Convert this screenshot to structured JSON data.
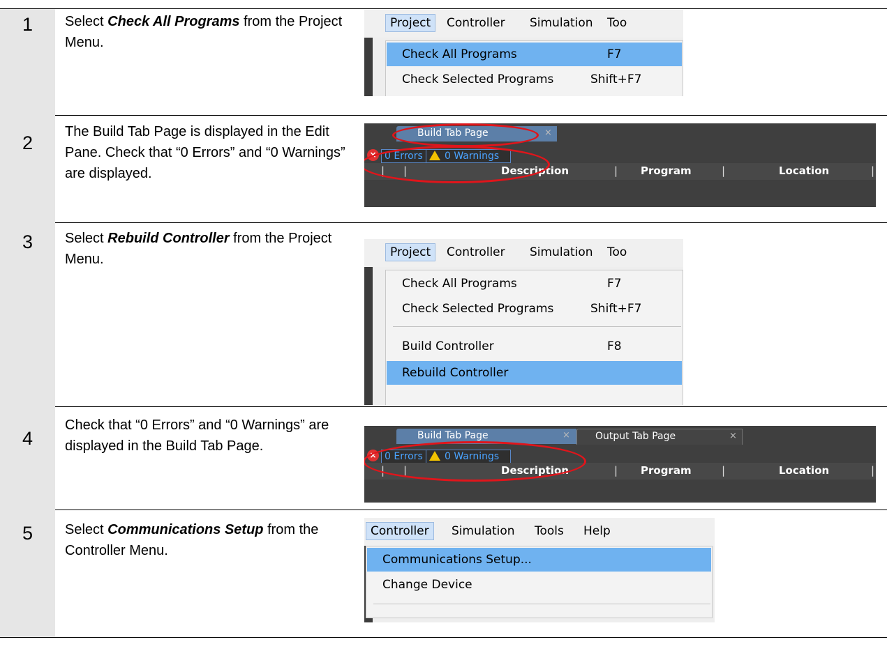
{
  "steps": [
    {
      "number": "1",
      "parts": [
        {
          "text": "Select ",
          "bold": false
        },
        {
          "text": "Check All Programs",
          "bold": true
        },
        {
          "text": " from the Project Menu.",
          "bold": false
        }
      ]
    },
    {
      "number": "2",
      "parts": [
        {
          "text": "The Build Tab Page is displayed in the Edit Pane. Check that “0 Errors” and “0 Warnings” are displayed.",
          "bold": false
        }
      ]
    },
    {
      "number": "3",
      "parts": [
        {
          "text": "Select ",
          "bold": false
        },
        {
          "text": "Rebuild Controller",
          "bold": true
        },
        {
          "text": " from the Project Menu.",
          "bold": false
        }
      ]
    },
    {
      "number": "4",
      "parts": [
        {
          "text": "Check that “0 Errors” and “0 Warnings” are displayed in the Build Tab Page.",
          "bold": false
        }
      ]
    },
    {
      "number": "5",
      "parts": [
        {
          "text": "Select ",
          "bold": false
        },
        {
          "text": "Communications Setup",
          "bold": true
        },
        {
          "text": " from the Controller Menu.",
          "bold": false
        }
      ]
    }
  ],
  "shot1": {
    "menubar": [
      "Project",
      "Controller",
      "Simulation",
      "Too"
    ],
    "items": [
      {
        "label": "Check All Programs",
        "shortcut": "F7"
      },
      {
        "label": "Check Selected Programs",
        "shortcut": "Shift+F7"
      }
    ]
  },
  "shot2": {
    "tab_label": "Build Tab Page",
    "tab_close": "×",
    "errors": "0  Errors",
    "warnings": "0  Warnings",
    "columns": [
      "Description",
      "Program",
      "Location"
    ]
  },
  "shot3": {
    "menubar": [
      "Project",
      "Controller",
      "Simulation",
      "Too"
    ],
    "items": [
      {
        "label": "Check All Programs",
        "shortcut": "F7"
      },
      {
        "label": "Check Selected Programs",
        "shortcut": "Shift+F7"
      },
      {
        "label": "Build Controller",
        "shortcut": "F8"
      },
      {
        "label": "Rebuild Controller",
        "shortcut": ""
      }
    ]
  },
  "shot4": {
    "tabs": [
      {
        "label": "Build Tab Page",
        "close": "×"
      },
      {
        "label": "Output Tab Page",
        "close": "×"
      }
    ],
    "errors": "0  Errors",
    "warnings": "0  Warnings",
    "columns": [
      "Description",
      "Program",
      "Location"
    ]
  },
  "shot5": {
    "menubar": [
      "Controller",
      "Simulation",
      "Tools",
      "Help"
    ],
    "items": [
      {
        "label": "Communications Setup..."
      },
      {
        "label": "Change Device"
      }
    ]
  },
  "colors": {
    "highlight": "#6fb2f0",
    "step_column": "#e6e6e6",
    "annotation_ellipse": "#e0151b",
    "dark_panel": "#3f3f3f"
  }
}
